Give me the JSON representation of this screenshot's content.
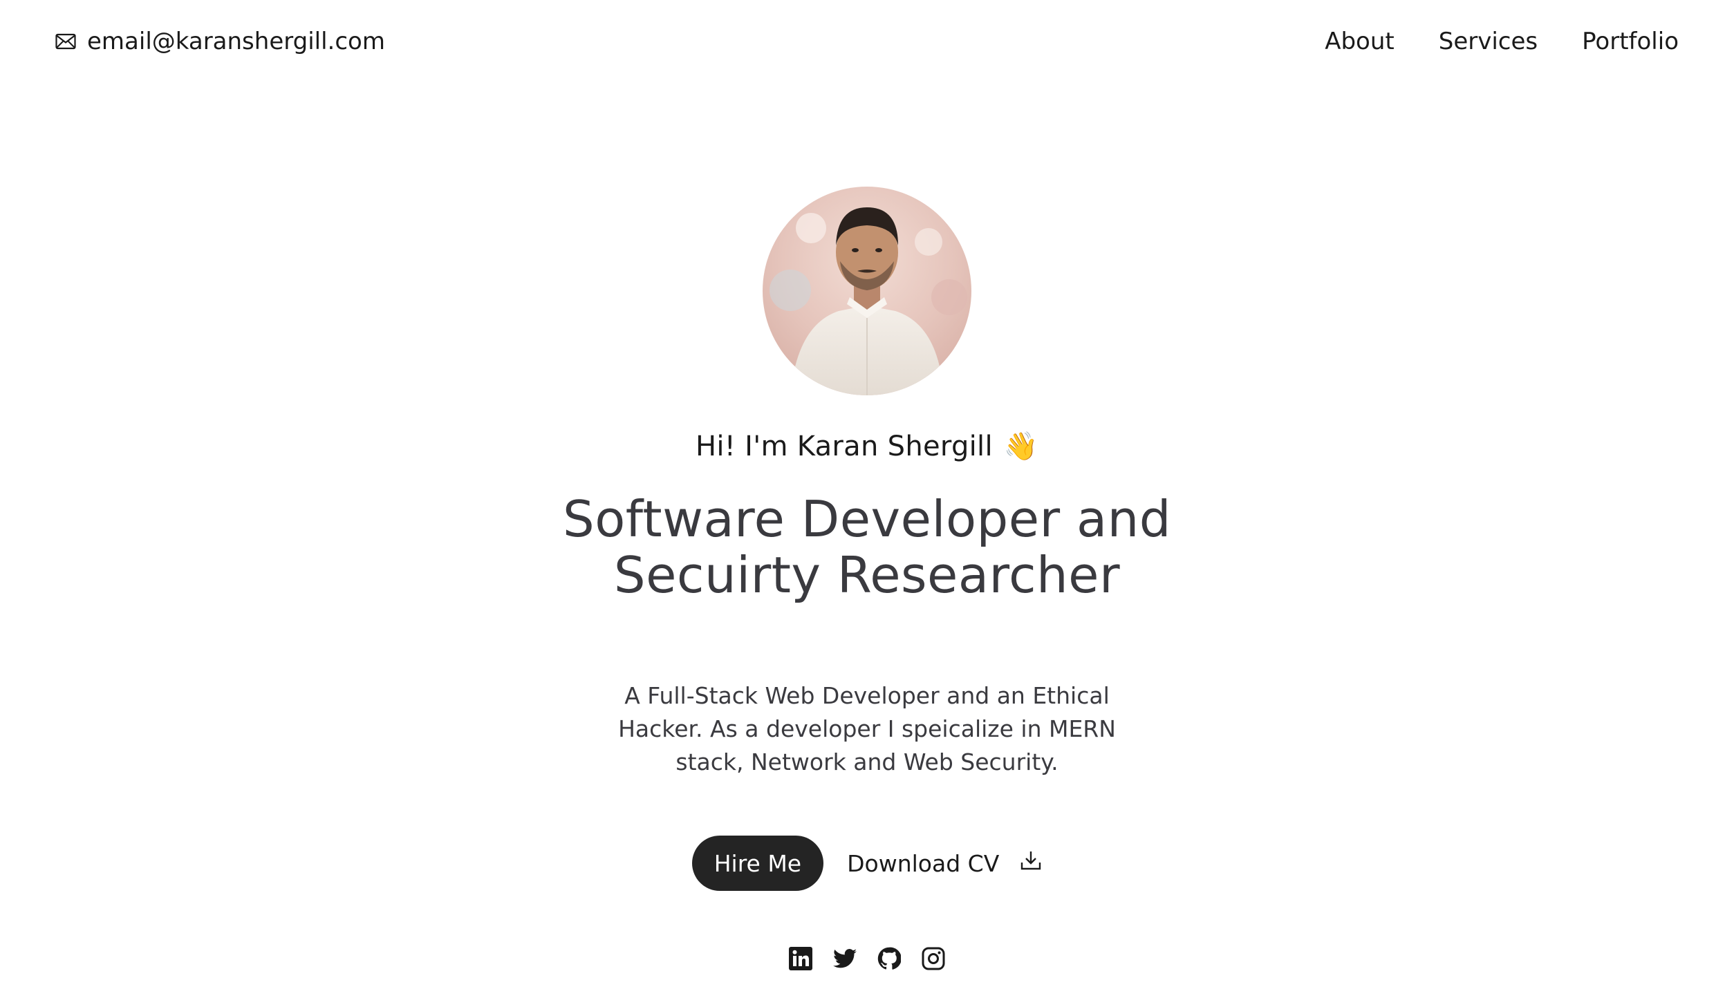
{
  "header": {
    "email": "email@karanshergill.com",
    "email_icon": "mail-icon",
    "nav": [
      {
        "label": "About"
      },
      {
        "label": "Services"
      },
      {
        "label": "Portfolio"
      }
    ]
  },
  "hero": {
    "avatar_icon": "profile-photo",
    "greeting": "Hi! I'm Karan Shergill",
    "greeting_emoji": "👋",
    "headline_line1": "Software Developer and",
    "headline_line2": "Secuirty Researcher",
    "description_line1": "A Full-Stack Web Developer and an Ethical",
    "description_line2": "Hacker. As a developer I speicalize in MERN",
    "description_line3": "stack, Network and Web Security.",
    "hire_label": "Hire Me",
    "cv_label": "Download CV",
    "cv_icon": "download-icon",
    "socials": [
      {
        "icon": "linkedin-icon"
      },
      {
        "icon": "twitter-icon"
      },
      {
        "icon": "github-icon"
      },
      {
        "icon": "instagram-icon"
      }
    ]
  },
  "colors": {
    "text": "#1a1a1a",
    "headline": "#3a3a3f",
    "button_bg": "#242424",
    "button_text": "#ffffff",
    "background": "#ffffff"
  }
}
